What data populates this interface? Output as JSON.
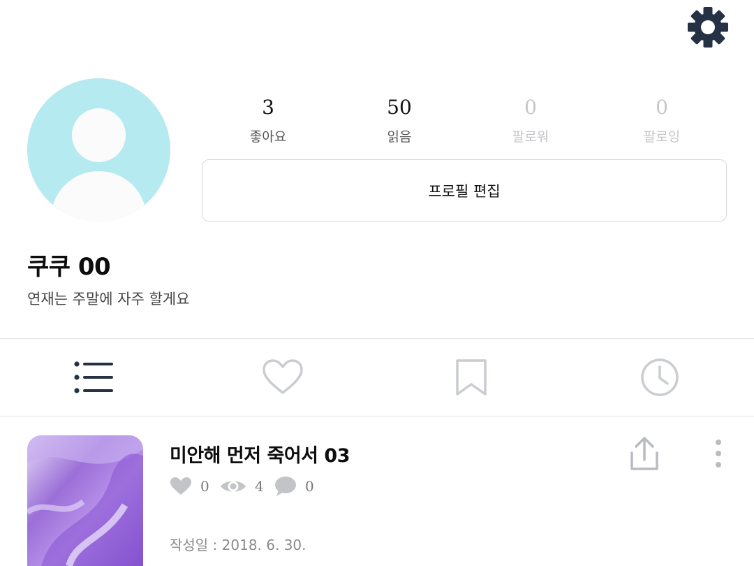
{
  "header": {
    "settings_icon": "gear-icon"
  },
  "profile": {
    "avatar_icon": "default-avatar",
    "avatar_color": "#b5eaf0",
    "stats": [
      {
        "value": "3",
        "label": "좋아요"
      },
      {
        "value": "50",
        "label": "읽음"
      },
      {
        "value": "0",
        "label": "팔로워"
      },
      {
        "value": "0",
        "label": "팔로잉"
      }
    ],
    "edit_label": "프로필 편집",
    "name": "쿠쿠 00",
    "bio": "연재는 주말에 자주 할게요"
  },
  "tabs": [
    {
      "icon": "list-icon",
      "active": true
    },
    {
      "icon": "heart-icon",
      "active": false
    },
    {
      "icon": "bookmark-icon",
      "active": false
    },
    {
      "icon": "clock-icon",
      "active": false
    }
  ],
  "post": {
    "title": "미안해 먼저 죽어서 03",
    "likes": "0",
    "views": "4",
    "comments": "0",
    "date": "작성일 : 2018. 6. 30."
  },
  "colors": {
    "accent_dark": "#253144",
    "inactive_icon": "#c9ccd1",
    "muted_text": "#c4c6c9"
  }
}
